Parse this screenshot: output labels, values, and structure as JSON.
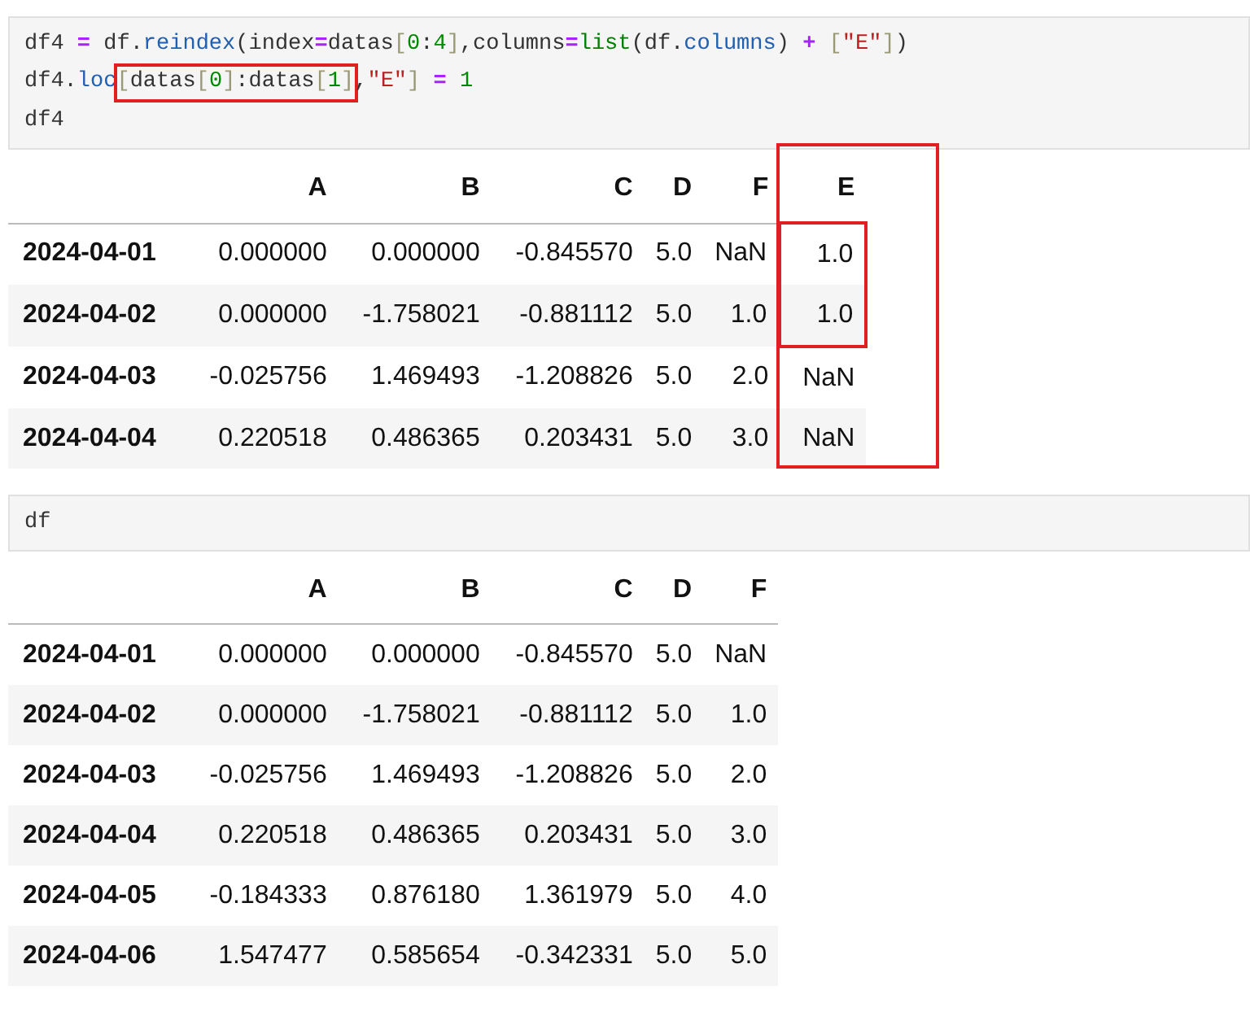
{
  "cells": [
    {
      "code_lines": [
        [
          {
            "text": "df4 ",
            "kind": "plain"
          },
          {
            "text": "=",
            "kind": "op"
          },
          {
            "text": " df.",
            "kind": "plain"
          },
          {
            "text": "reindex",
            "kind": "attr"
          },
          {
            "text": "(index",
            "kind": "plain"
          },
          {
            "text": "=",
            "kind": "op"
          },
          {
            "text": "datas",
            "kind": "plain"
          },
          {
            "text": "[",
            "kind": "bracket"
          },
          {
            "text": "0",
            "kind": "num"
          },
          {
            "text": ":",
            "kind": "plain"
          },
          {
            "text": "4",
            "kind": "num"
          },
          {
            "text": "]",
            "kind": "bracket"
          },
          {
            "text": ",columns",
            "kind": "plain"
          },
          {
            "text": "=",
            "kind": "op"
          },
          {
            "text": "list",
            "kind": "builtin"
          },
          {
            "text": "(df.",
            "kind": "plain"
          },
          {
            "text": "columns",
            "kind": "attr"
          },
          {
            "text": ") ",
            "kind": "plain"
          },
          {
            "text": "+",
            "kind": "op"
          },
          {
            "text": " [",
            "kind": "bracket"
          },
          {
            "text": "\"E\"",
            "kind": "str"
          },
          {
            "text": "]",
            "kind": "bracket"
          },
          {
            "text": ")",
            "kind": "plain"
          }
        ],
        [
          {
            "text": "df4.",
            "kind": "plain"
          },
          {
            "text": "loc",
            "kind": "attr"
          },
          {
            "kind": "highlight",
            "boxed": true,
            "tokens": [
              {
                "text": "[",
                "kind": "bracket"
              },
              {
                "text": "datas",
                "kind": "plain"
              },
              {
                "text": "[",
                "kind": "bracket"
              },
              {
                "text": "0",
                "kind": "num"
              },
              {
                "text": "]",
                "kind": "bracket"
              },
              {
                "text": ":datas",
                "kind": "plain"
              },
              {
                "text": "[",
                "kind": "bracket"
              },
              {
                "text": "1",
                "kind": "num"
              },
              {
                "text": "]",
                "kind": "bracket"
              }
            ]
          },
          {
            "text": ",",
            "kind": "plain"
          },
          {
            "text": "\"E\"",
            "kind": "str"
          },
          {
            "text": "] ",
            "kind": "bracket"
          },
          {
            "text": "=",
            "kind": "op"
          },
          {
            "text": " 1",
            "kind": "num"
          }
        ],
        [
          {
            "text": "df4",
            "kind": "plain"
          }
        ]
      ],
      "output": {
        "columns": [
          {
            "label": "A"
          },
          {
            "label": "B"
          },
          {
            "label": "C"
          },
          {
            "label": "D"
          },
          {
            "label": "F"
          },
          {
            "label": "E",
            "boxed": true
          }
        ],
        "rows": [
          {
            "index": "2024-04-01",
            "values": [
              {
                "text": "0.000000"
              },
              {
                "text": "0.000000"
              },
              {
                "text": "-0.845570"
              },
              {
                "text": "5.0"
              },
              {
                "text": "NaN"
              },
              {
                "text": "1.0",
                "boxed": true
              }
            ]
          },
          {
            "index": "2024-04-02",
            "values": [
              {
                "text": "0.000000"
              },
              {
                "text": "-1.758021"
              },
              {
                "text": "-0.881112"
              },
              {
                "text": "5.0"
              },
              {
                "text": "1.0"
              },
              {
                "text": "1.0",
                "boxed": true
              }
            ]
          },
          {
            "index": "2024-04-03",
            "values": [
              {
                "text": "-0.025756"
              },
              {
                "text": "1.469493"
              },
              {
                "text": "-1.208826"
              },
              {
                "text": "5.0"
              },
              {
                "text": "2.0"
              },
              {
                "text": "NaN"
              }
            ]
          },
          {
            "index": "2024-04-04",
            "values": [
              {
                "text": "0.220518"
              },
              {
                "text": "0.486365"
              },
              {
                "text": "0.203431"
              },
              {
                "text": "5.0"
              },
              {
                "text": "3.0"
              },
              {
                "text": "NaN"
              }
            ]
          }
        ]
      }
    },
    {
      "code_lines": [
        [
          {
            "text": "df",
            "kind": "plain"
          }
        ]
      ],
      "output": {
        "columns": [
          {
            "label": "A"
          },
          {
            "label": "B"
          },
          {
            "label": "C"
          },
          {
            "label": "D"
          },
          {
            "label": "F"
          }
        ],
        "rows": [
          {
            "index": "2024-04-01",
            "values": [
              {
                "text": "0.000000"
              },
              {
                "text": "0.000000"
              },
              {
                "text": "-0.845570"
              },
              {
                "text": "5.0"
              },
              {
                "text": "NaN"
              }
            ]
          },
          {
            "index": "2024-04-02",
            "values": [
              {
                "text": "0.000000"
              },
              {
                "text": "-1.758021"
              },
              {
                "text": "-0.881112"
              },
              {
                "text": "5.0"
              },
              {
                "text": "1.0"
              }
            ]
          },
          {
            "index": "2024-04-03",
            "values": [
              {
                "text": "-0.025756"
              },
              {
                "text": "1.469493"
              },
              {
                "text": "-1.208826"
              },
              {
                "text": "5.0"
              },
              {
                "text": "2.0"
              }
            ]
          },
          {
            "index": "2024-04-04",
            "values": [
              {
                "text": "0.220518"
              },
              {
                "text": "0.486365"
              },
              {
                "text": "0.203431"
              },
              {
                "text": "5.0"
              },
              {
                "text": "3.0"
              }
            ]
          },
          {
            "index": "2024-04-05",
            "values": [
              {
                "text": "-0.184333"
              },
              {
                "text": "0.876180"
              },
              {
                "text": "1.361979"
              },
              {
                "text": "5.0"
              },
              {
                "text": "4.0"
              }
            ]
          },
          {
            "index": "2024-04-06",
            "values": [
              {
                "text": "1.547477"
              },
              {
                "text": "0.585654"
              },
              {
                "text": "-0.342331"
              },
              {
                "text": "5.0"
              },
              {
                "text": "5.0"
              }
            ]
          }
        ]
      }
    }
  ]
}
